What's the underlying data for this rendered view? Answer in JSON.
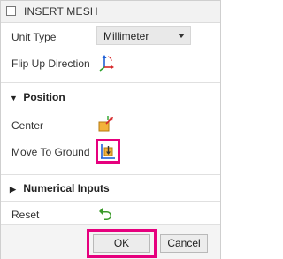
{
  "title": "INSERT MESH",
  "unit_type": {
    "label": "Unit Type",
    "selected": "Millimeter"
  },
  "flip_up": {
    "label": "Flip Up Direction",
    "icon": "flip-axes-icon"
  },
  "position": {
    "header": "Position",
    "center_label": "Center",
    "center_icon": "center-icon",
    "move_to_ground_label": "Move To Ground",
    "move_to_ground_icon": "move-to-ground-icon"
  },
  "numerical": {
    "header": "Numerical Inputs"
  },
  "reset": {
    "label": "Reset",
    "icon": "reset-undo-icon"
  },
  "buttons": {
    "ok": "OK",
    "cancel": "Cancel"
  },
  "colors": {
    "highlight": "#e6007e",
    "reset_green": "#3a9a2a",
    "axis_red": "#d6282a",
    "axis_blue": "#1f5fd6",
    "axis_green": "#2aa12a"
  }
}
